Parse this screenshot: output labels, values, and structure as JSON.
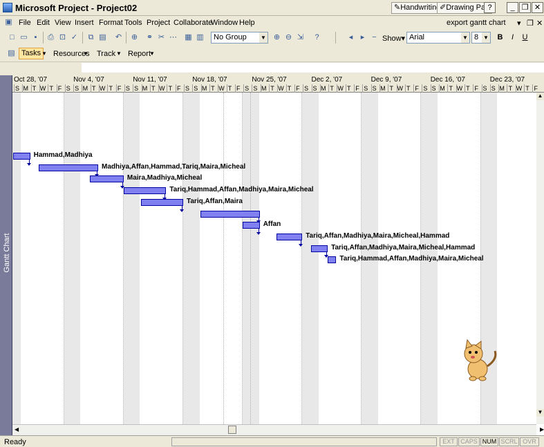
{
  "window": {
    "title": "Microsoft Project - Project02",
    "handwriting": "Handwriting",
    "drawing_pad": "Drawing Pad",
    "help_q": "?",
    "question_box": "export gantt chart"
  },
  "menu": [
    "File",
    "Edit",
    "View",
    "Insert",
    "Format",
    "Tools",
    "Project",
    "Collaborate",
    "Window",
    "Help"
  ],
  "toolbar": {
    "group_value": "No Group",
    "show_label": "Show",
    "font_value": "Arial",
    "font_size": "8",
    "bold": "B",
    "italic": "I",
    "underline": "U"
  },
  "guide": {
    "tasks": "Tasks",
    "resources": "Resources",
    "track": "Track",
    "report": "Report"
  },
  "view_bar_label": "Gantt Chart",
  "timescale": {
    "weeks": [
      "Oct 28, '07",
      "Nov 4, '07",
      "Nov 11, '07",
      "Nov 18, '07",
      "Nov 25, '07",
      "Dec 2, '07",
      "Dec 9, '07",
      "Dec 16, '07",
      "Dec 23, '07"
    ],
    "days": [
      "S",
      "M",
      "T",
      "W",
      "T",
      "F",
      "S"
    ]
  },
  "tasks": [
    {
      "resources": "Hammad,Madhiya",
      "start": 0,
      "duration": 2
    },
    {
      "resources": "Madhiya,Affan,Hammad,Tariq,Maira,Micheal",
      "start": 3,
      "duration": 7
    },
    {
      "resources": "Maira,Madhiya,Micheal",
      "start": 9,
      "duration": 4
    },
    {
      "resources": "Tariq,Hammad,Affan,Madhiya,Maira,Micheal",
      "start": 13,
      "duration": 5
    },
    {
      "resources": "Tariq,Affan,Maira",
      "start": 15,
      "duration": 5
    },
    {
      "resources": "",
      "start": 22,
      "duration": 7
    },
    {
      "resources": "Affan",
      "start": 27,
      "duration": 2
    },
    {
      "resources": "Tariq,Affan,Madhiya,Maira,Micheal,Hammad",
      "start": 31,
      "duration": 3
    },
    {
      "resources": "Tariq,Affan,Madhiya,Maira,Micheal,Hammad",
      "start": 35,
      "duration": 2
    },
    {
      "resources": "Tariq,Hammad,Affan,Madhiya,Maira,Micheal",
      "start": 37,
      "duration": 1
    }
  ],
  "status": {
    "ready": "Ready",
    "ext": "EXT",
    "caps": "CAPS",
    "num": "NUM",
    "scrl": "SCRL",
    "ovr": "OVR"
  },
  "colors": {
    "bar": "#8080f0",
    "bar_border": "#0000a0"
  }
}
